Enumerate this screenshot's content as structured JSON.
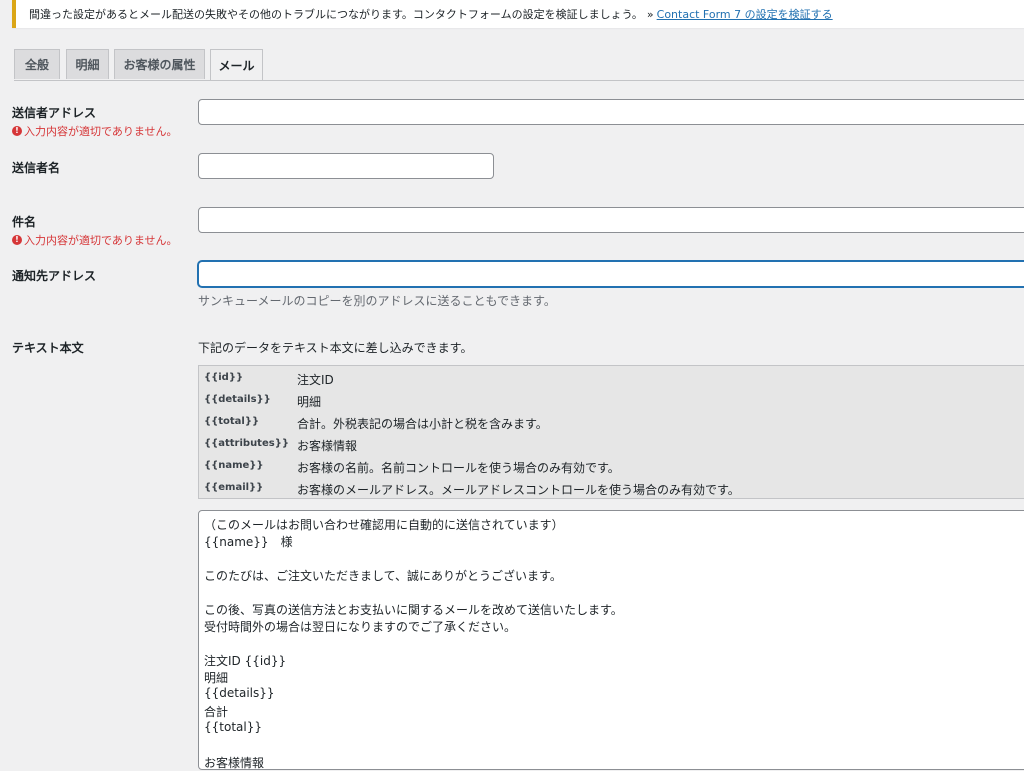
{
  "notice": {
    "message": "間違った設定があるとメール配送の失敗やその他のトラブルにつながります。コンタクトフォームの設定を検証しましょう。",
    "raquo": "»",
    "link_text": "Contact Form 7 の設定を検証する",
    "border_color": "#dba617"
  },
  "tabs": [
    {
      "label": "全般"
    },
    {
      "label": "明細"
    },
    {
      "label": "お客様の属性"
    },
    {
      "label": "メール",
      "active": true
    }
  ],
  "fields": {
    "sender_address": {
      "label": "送信者アドレス",
      "error": "入力内容が適切でありません。",
      "value": ""
    },
    "sender_name": {
      "label": "送信者名",
      "value": ""
    },
    "subject": {
      "label": "件名",
      "error": "入力内容が適切でありません。",
      "value": ""
    },
    "notify_address": {
      "label": "通知先アドレス",
      "value": "",
      "description": "サンキューメールのコピーを別のアドレスに送ることもできます。"
    }
  },
  "body_text": {
    "label": "テキスト本文",
    "hint": "下記のデータをテキスト本文に差し込みできます。",
    "tags": [
      {
        "tag": "{{id}}",
        "desc": "注文ID"
      },
      {
        "tag": "{{details}}",
        "desc": "明細"
      },
      {
        "tag": "{{total}}",
        "desc": "合計。外税表記の場合は小計と税を含みます。"
      },
      {
        "tag": "{{attributes}}",
        "desc": "お客様情報"
      },
      {
        "tag": "{{name}}",
        "desc": "お客様の名前。名前コントロールを使う場合のみ有効です。"
      },
      {
        "tag": "{{email}}",
        "desc": "お客様のメールアドレス。メールアドレスコントロールを使う場合のみ有効です。"
      }
    ],
    "content_lines": [
      "（このメールはお問い合わせ確認用に自動的に送信されています）",
      " {{name}}　様",
      "",
      "このたびは、ご注文いただきまして、誠にありがとうございます。",
      "",
      "この後、写真の送信方法とお支払いに関するメールを改めて送信いたします。",
      "受付時間外の場合は翌日になりますのでご了承ください。",
      "",
      "注文ID {{id}}",
      "明細",
      "{{details}}",
      "合計",
      "{{total}}",
      "",
      "お客様情報"
    ]
  },
  "colors": {
    "error": "#d63638",
    "link": "#2271b1",
    "focus": "#2271b1",
    "background": "#f0f0f1"
  }
}
